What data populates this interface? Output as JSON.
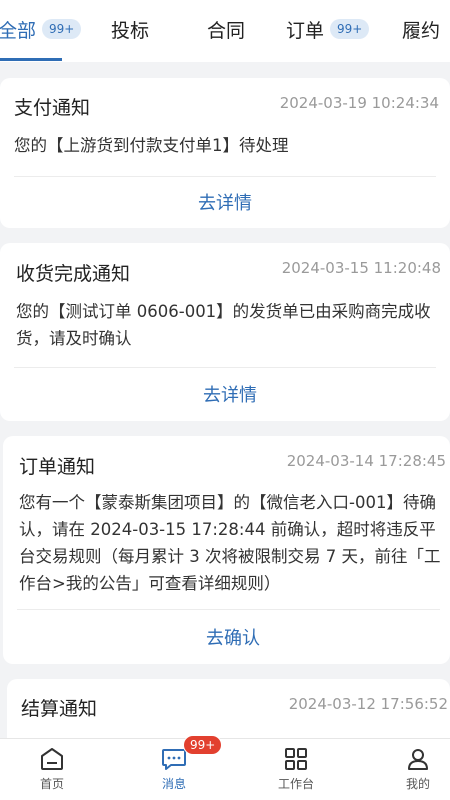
{
  "tabs": [
    {
      "label": "全部",
      "badge": "99+"
    },
    {
      "label": "投标"
    },
    {
      "label": "合同"
    },
    {
      "label": "订单",
      "badge": "99+"
    },
    {
      "label": "履约"
    }
  ],
  "cards": [
    {
      "title": "支付通知",
      "time": "2024-03-19 10:24:34",
      "body": "您的【上游货到付款支付单1】待处理",
      "action": "去详情"
    },
    {
      "title": "收货完成通知",
      "time": "2024-03-15 11:20:48",
      "body": "您的【测试订单 0606-001】的发货单已由采购商完成收货，请及时确认",
      "action": "去详情"
    },
    {
      "title": "订单通知",
      "time": "2024-03-14 17:28:45",
      "body": "您有一个【蒙泰斯集团项目】的【微信老入口-001】待确认，请在 2024-03-15 17:28:44 前确认，超时将违反平台交易规则（每月累计 3 次将被限制交易 7 天，前往「工作台>我的公告」可查看详细规则）",
      "action": "去确认"
    },
    {
      "title": "结算通知",
      "time": "2024-03-12 17:56:52"
    }
  ],
  "nav": [
    {
      "label": "首页",
      "icon": "home-icon"
    },
    {
      "label": "消息",
      "icon": "message-icon",
      "badge": "99+"
    },
    {
      "label": "工作台",
      "icon": "workbench-icon"
    },
    {
      "label": "我的",
      "icon": "profile-icon"
    }
  ],
  "colors": {
    "accent": "#2f6db5",
    "badge_red": "#e2402f"
  }
}
